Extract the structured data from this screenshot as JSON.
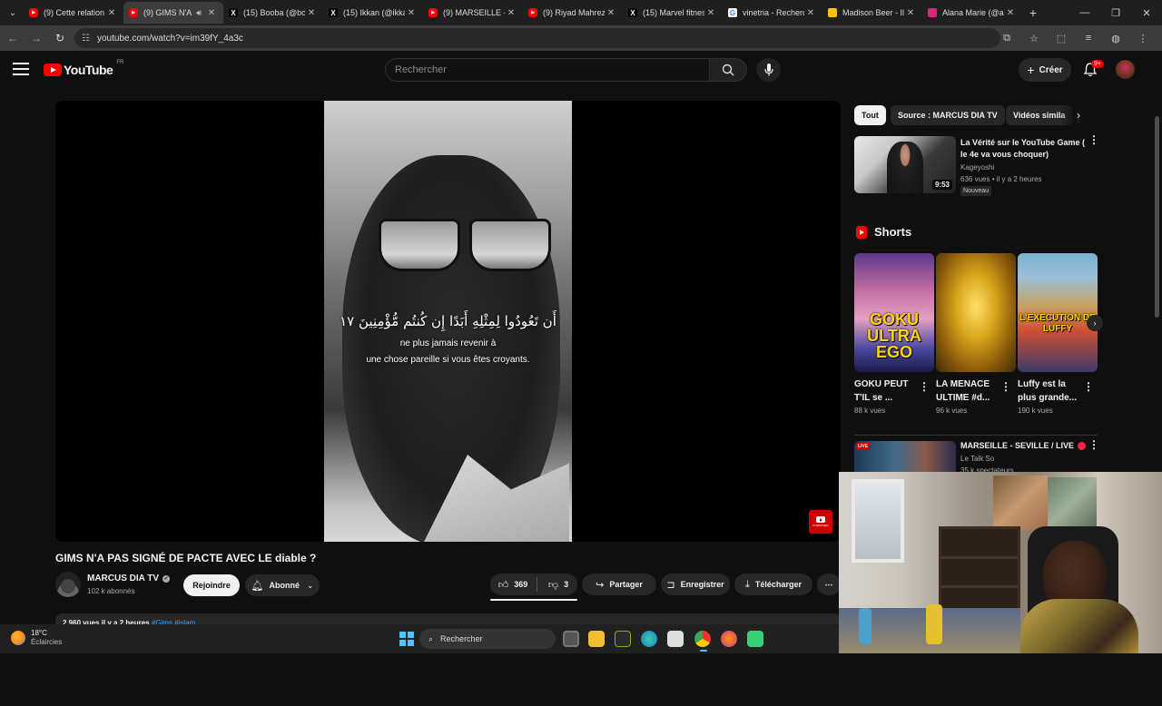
{
  "browser": {
    "tabs": [
      {
        "label": "(9) Cette relation",
        "favicon": "youtube-icon",
        "active": false
      },
      {
        "label": "(9) GIMS N'A",
        "favicon": "youtube-icon",
        "active": true,
        "audio": true
      },
      {
        "label": "(15) Booba (@bo",
        "favicon": "x-icon",
        "active": false
      },
      {
        "label": "(15) Ikkan (@ikka",
        "favicon": "x-icon",
        "active": false
      },
      {
        "label": "(9) MARSEILLE - S",
        "favicon": "youtube-icon",
        "active": false
      },
      {
        "label": "(9) Riyad Mahrez",
        "favicon": "youtube-icon",
        "active": false
      },
      {
        "label": "(15) Marvel fitnes",
        "favicon": "x-icon",
        "active": false
      },
      {
        "label": "vinetria - Recherc",
        "favicon": "google-icon",
        "active": false
      },
      {
        "label": "Madison Beer - Il",
        "favicon": "bookmark-yellow-icon",
        "active": false
      },
      {
        "label": "Alana Marie (@al",
        "favicon": "instagram-icon",
        "active": false
      }
    ],
    "url": "youtube.com/watch?v=im39fY_4a3c"
  },
  "youtube": {
    "logo_text": "YouTube",
    "country": "FR",
    "search_placeholder": "Rechercher",
    "create_label": "Créer",
    "notif_badge": "9+",
    "video": {
      "arabic_caption": "أَن تَعُودُوا لِمِثْلِهِ أَبَدًا إِن كُنتُم مُّؤْمِنِينَ",
      "verse_number": "١٧",
      "caption_line1": "ne plus jamais revenir à",
      "caption_line2": "une chose pareille si vous êtes croyants.",
      "watermark_label": "S'ABONNER"
    },
    "title": "GIMS N'A PAS SIGNÉ DE PACTE AVEC LE diable ?",
    "channel": {
      "name": "MARCUS DIA TV",
      "subs": "102 k abonnés"
    },
    "actions": {
      "join": "Rejoindre",
      "subscribed": "Abonné",
      "likes": "369",
      "dislikes": "3",
      "share": "Partager",
      "save": "Enregistrer",
      "download": "Télécharger"
    },
    "description": {
      "stats": "2 960 vues  il y a 2 heures",
      "tags": "#Gims #islam"
    },
    "chips": [
      "Tout",
      "Source : MARCUS DIA TV",
      "Vidéos simila"
    ],
    "recommended": {
      "title": "La Vérité sur le YouTube Game ( le 4e va vous choquer)",
      "channel": "Kageyoshi",
      "meta": "636 vues • il y a 2 heures",
      "badge": "Nouveau",
      "duration": "9:53"
    },
    "shorts_heading": "Shorts",
    "shorts": [
      {
        "title": "GOKU PEUT T'IL se ...",
        "views": "88 k vues",
        "overlay": "GOKU ULTRA EGO"
      },
      {
        "title": "LA MENACE ULTIME #d...",
        "views": "96 k vues",
        "overlay": ""
      },
      {
        "title": "Luffy est la plus grande...",
        "views": "190 k vues",
        "overlay": "L'EXECUTION DE LUFFY"
      }
    ],
    "live": {
      "title": "MARSEILLE - SEVILLE / LIVE",
      "channel": "Le Talk So",
      "meta": "35 k spectateurs",
      "badge": "LIVE"
    }
  },
  "taskbar": {
    "temp": "18°C",
    "weather": "Éclaircies",
    "search": "Rechercher"
  }
}
